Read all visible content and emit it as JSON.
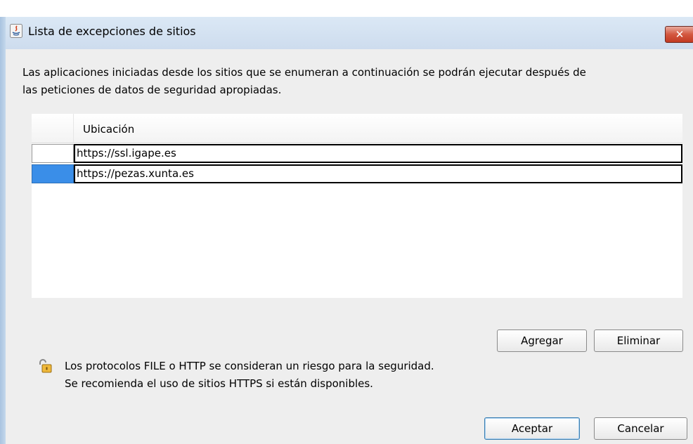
{
  "window": {
    "title": "Lista de excepciones de sitios",
    "close_label": "✕"
  },
  "description": {
    "line1": "Las aplicaciones iniciadas desde los sitios que se enumeran a continuación se podrán ejecutar después de",
    "line2": "las peticiones de datos de seguridad apropiadas."
  },
  "table": {
    "column_header": "Ubicación",
    "rows": [
      {
        "url": "https://ssl.igape.es",
        "selected": false
      },
      {
        "url": "https://pezas.xunta.es",
        "selected": true
      }
    ]
  },
  "buttons": {
    "add": "Agregar",
    "remove": "Eliminar",
    "ok": "Aceptar",
    "cancel": "Cancelar"
  },
  "warning": {
    "line1": "Los protocolos FILE o HTTP se consideran un riesgo para la seguridad.",
    "line2": "Se recomienda el uso de sitios HTTPS si están disponibles."
  },
  "colors": {
    "selection": "#3a8ee8",
    "close_button": "#c9452e",
    "titlebar": "#d5e3f2"
  }
}
